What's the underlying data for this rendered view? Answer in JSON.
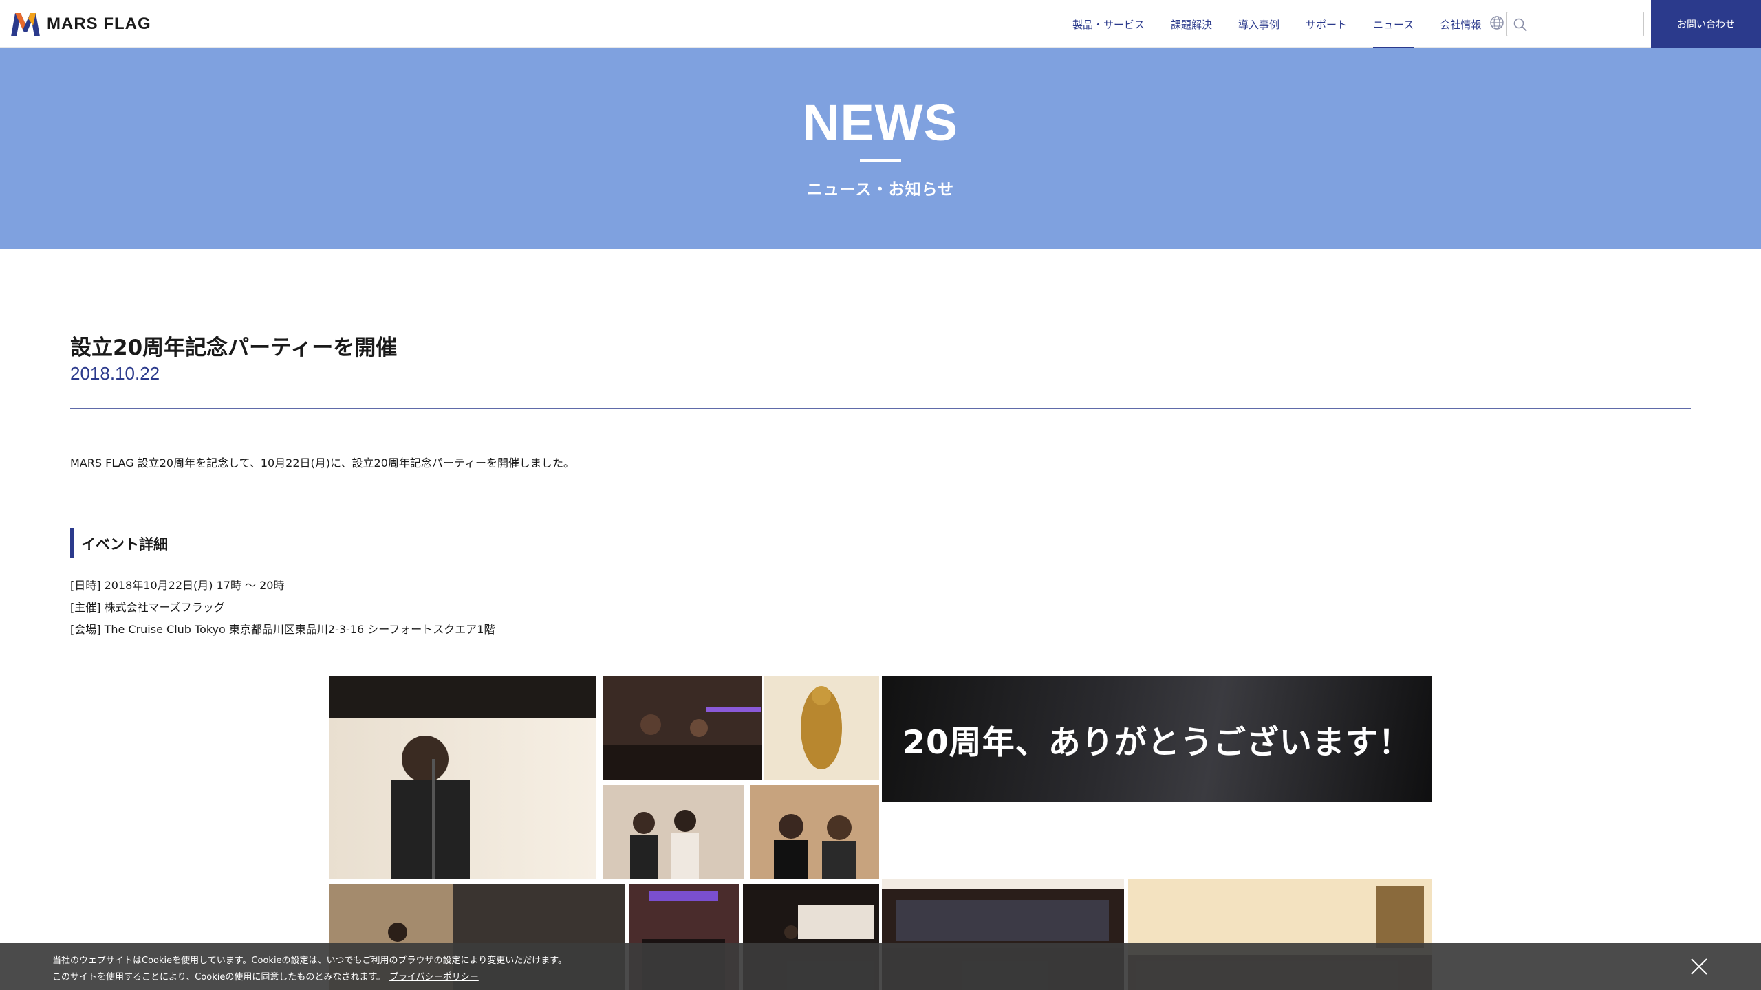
{
  "header": {
    "logo_text": "MARS FLAG",
    "nav": [
      {
        "label": "製品・サービス"
      },
      {
        "label": "課題解決"
      },
      {
        "label": "導入事例"
      },
      {
        "label": "サポート"
      },
      {
        "label": "ニュース",
        "active": true
      },
      {
        "label": "会社情報"
      }
    ],
    "search_value": "",
    "contact_label": "お問い合わせ",
    "accent_color": "#2b3a8c",
    "icons": [
      "globe-icon",
      "search-icon"
    ]
  },
  "hero": {
    "title": "NEWS",
    "subtitle": "ニュース・お知らせ",
    "background": "#7fa1df"
  },
  "article": {
    "title": "設立20周年記念パーティーを開催",
    "date": "2018.10.22",
    "lead": "MARS FLAG 設立20周年を記念して、10月22日(月)に、設立20周年記念パーティーを開催しました。",
    "section_heading": "イベント詳細",
    "details": [
      "[日時] 2018年10月22日(月) 17時 〜 20時",
      "[主催] 株式会社マーズフラッグ",
      "[会場] The Cruise Club Tokyo 東京都品川区東品川2-3-16 シーフォートスクエア1階"
    ],
    "banner_text": "20周年、ありがとうございます！"
  },
  "cookie": {
    "line1": "当社のウェブサイトはCookieを使用しています。Cookieの設定は、いつでもご利用のブラウザの設定により変更いただけます。",
    "line2": "このサイトを使用することにより、Cookieの使用に同意したものとみなされます。",
    "link_label": "プライバシーポリシー"
  }
}
